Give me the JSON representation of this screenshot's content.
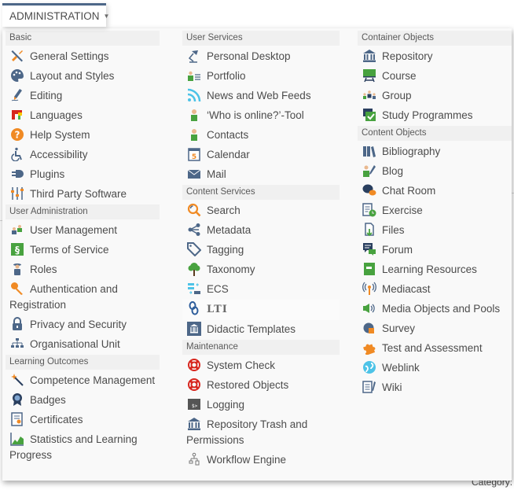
{
  "top_menu": {
    "label": "ADMINISTRATION"
  },
  "background": {
    "category_label": "Category:"
  },
  "columns": [
    {
      "groups": [
        {
          "header": "Basic",
          "items": [
            {
              "label": "General Settings",
              "icon": "tools-icon"
            },
            {
              "label": "Layout and Styles",
              "icon": "palette-icon"
            },
            {
              "label": "Editing",
              "icon": "pen-icon"
            },
            {
              "label": "Languages",
              "icon": "languages-icon"
            },
            {
              "label": "Help System",
              "icon": "help-icon"
            },
            {
              "label": "Accessibility",
              "icon": "wheelchair-icon"
            },
            {
              "label": "Plugins",
              "icon": "plug-icon"
            },
            {
              "label": "Third Party Software",
              "icon": "sliders-icon"
            }
          ]
        },
        {
          "header": "User Administration",
          "items": [
            {
              "label": "User Management",
              "icon": "users-icon"
            },
            {
              "label": "Terms of Service",
              "icon": "paragraph-icon"
            },
            {
              "label": "Roles",
              "icon": "role-icon"
            },
            {
              "label": "Authentication and Registration",
              "icon": "key-icon"
            },
            {
              "label": "Privacy and Security",
              "icon": "lock-icon"
            },
            {
              "label": "Organisational Unit",
              "icon": "org-chart-icon"
            }
          ]
        },
        {
          "header": "Learning Outcomes",
          "items": [
            {
              "label": "Competence Management",
              "icon": "magic-wand-icon"
            },
            {
              "label": "Badges",
              "icon": "badge-icon"
            },
            {
              "label": "Certificates",
              "icon": "certificate-icon"
            },
            {
              "label": "Statistics and Learning Progress",
              "icon": "chart-icon"
            }
          ]
        }
      ]
    },
    {
      "groups": [
        {
          "header": "User Services",
          "items": [
            {
              "label": "Personal Desktop",
              "icon": "desk-lamp-icon"
            },
            {
              "label": "Portfolio",
              "icon": "portfolio-icon"
            },
            {
              "label": "News and Web Feeds",
              "icon": "rss-icon"
            },
            {
              "label": "‘Who is online?’-Tool",
              "icon": "user-online-icon"
            },
            {
              "label": "Contacts",
              "icon": "contact-icon"
            },
            {
              "label": "Calendar",
              "icon": "calendar-icon"
            },
            {
              "label": "Mail",
              "icon": "mail-icon"
            }
          ]
        },
        {
          "header": "Content Services",
          "items": [
            {
              "label": "Search",
              "icon": "search-icon"
            },
            {
              "label": "Metadata",
              "icon": "share-icon"
            },
            {
              "label": "Tagging",
              "icon": "tag-icon"
            },
            {
              "label": "Taxonomy",
              "icon": "tree-icon"
            },
            {
              "label": "ECS",
              "icon": "ecs-icon"
            },
            {
              "label": "LTI",
              "icon": "link-icon"
            },
            {
              "label": "Didactic Templates",
              "icon": "template-icon"
            }
          ]
        },
        {
          "header": "Maintenance",
          "items": [
            {
              "label": "System Check",
              "icon": "lifebuoy-icon"
            },
            {
              "label": "Restored Objects",
              "icon": "lifebuoy-icon"
            },
            {
              "label": "Logging",
              "icon": "terminal-icon"
            },
            {
              "label": "Repository Trash and Permissions",
              "icon": "repository-icon"
            },
            {
              "label": "Workflow Engine",
              "icon": "workflow-icon"
            }
          ]
        }
      ]
    },
    {
      "groups": [
        {
          "header": "Container Objects",
          "items": [
            {
              "label": "Repository",
              "icon": "repository-icon"
            },
            {
              "label": "Course",
              "icon": "course-icon"
            },
            {
              "label": "Group",
              "icon": "group-icon"
            },
            {
              "label": "Study Programmes",
              "icon": "study-programme-icon"
            }
          ]
        },
        {
          "header": "Content Objects",
          "items": [
            {
              "label": "Bibliography",
              "icon": "books-icon"
            },
            {
              "label": "Blog",
              "icon": "blog-icon"
            },
            {
              "label": "Chat Room",
              "icon": "chat-icon"
            },
            {
              "label": "Exercise",
              "icon": "exercise-icon"
            },
            {
              "label": "Files",
              "icon": "file-icon"
            },
            {
              "label": "Forum",
              "icon": "forum-icon"
            },
            {
              "label": "Learning Resources",
              "icon": "book-icon"
            },
            {
              "label": "Mediacast",
              "icon": "broadcast-icon"
            },
            {
              "label": "Media Objects and Pools",
              "icon": "speaker-icon"
            },
            {
              "label": "Survey",
              "icon": "survey-icon"
            },
            {
              "label": "Test and Assessment",
              "icon": "puzzle-icon"
            },
            {
              "label": "Weblink",
              "icon": "globe-icon"
            },
            {
              "label": "Wiki",
              "icon": "wiki-icon"
            }
          ]
        }
      ]
    }
  ]
}
